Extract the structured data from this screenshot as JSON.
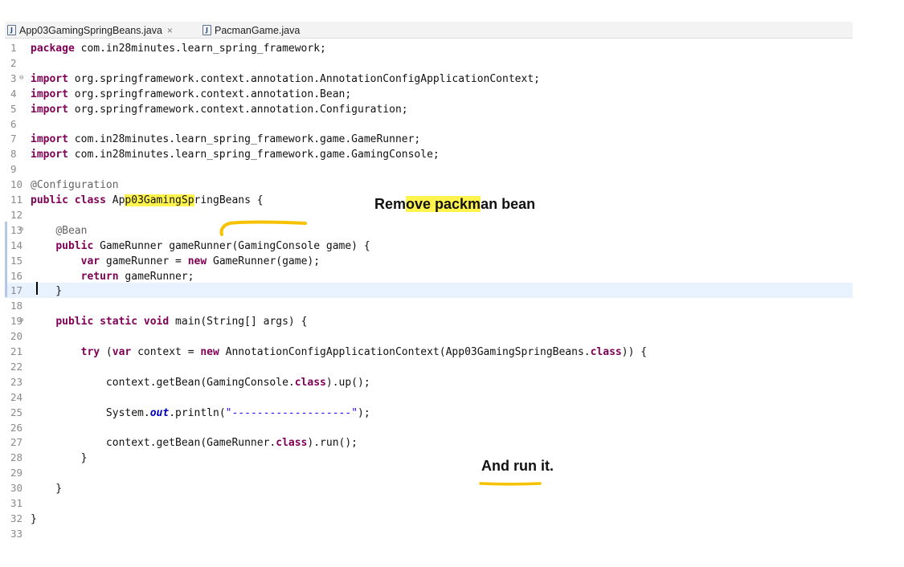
{
  "tabs": [
    {
      "label": "App03GamingSpringBeans.java",
      "active": true,
      "closable": true
    },
    {
      "label": "PacmanGame.java",
      "active": false,
      "closable": false
    }
  ],
  "icons": {
    "file": "java-file-icon",
    "close": "close-icon",
    "fold": "fold-minus-icon"
  },
  "colors": {
    "keyword": "#7f0055",
    "annotation": "#646464",
    "string": "#2a00ff",
    "highlight": "#fff34d",
    "pen": "#f6c200",
    "current_line": "#e8f2fe"
  },
  "code_lines": [
    {
      "n": "1",
      "html": "<span class='kw'>package</span> com.in28minutes.learn_spring_framework;"
    },
    {
      "n": "2",
      "html": ""
    },
    {
      "n": "3",
      "fold": true,
      "html": "<span class='kw'>import</span> org.springframework.context.annotation.AnnotationConfigApplicationContext;"
    },
    {
      "n": "4",
      "html": "<span class='kw'>import</span> org.springframework.context.annotation.Bean;"
    },
    {
      "n": "5",
      "html": "<span class='kw'>import</span> org.springframework.context.annotation.Configuration;"
    },
    {
      "n": "6",
      "html": ""
    },
    {
      "n": "7",
      "html": "<span class='kw'>import</span> com.in28minutes.learn_spring_framework.game.GameRunner;"
    },
    {
      "n": "8",
      "html": "<span class='kw'>import</span> com.in28minutes.learn_spring_framework.game.GamingConsole;"
    },
    {
      "n": "9",
      "html": ""
    },
    {
      "n": "10",
      "html": "<span class='an'>@Configuration</span>"
    },
    {
      "n": "11",
      "html": "<span class='kw'>public</span> <span class='kw'>class</span> Ap<span class='hl'>p03GamingSp</span>ringBeans {"
    },
    {
      "n": "12",
      "html": ""
    },
    {
      "n": "13",
      "fold": true,
      "html": "    <span class='an'>@Bean</span>"
    },
    {
      "n": "14",
      "html": "    <span class='kw'>public</span> GameRunner gameRunner(GamingConsole game) {"
    },
    {
      "n": "15",
      "html": "        <span class='kw'>var</span> gameRunner = <span class='kw'>new</span> GameRunner(game);"
    },
    {
      "n": "16",
      "html": "        <span class='kw'>return</span> gameRunner;"
    },
    {
      "n": "17",
      "current": true,
      "html": "    }"
    },
    {
      "n": "18",
      "html": ""
    },
    {
      "n": "19",
      "fold": true,
      "html": "    <span class='kw'>public</span> <span class='kw'>static</span> <span class='kw'>void</span> main(String[] args) {"
    },
    {
      "n": "20",
      "html": ""
    },
    {
      "n": "21",
      "html": "        <span class='kw'>try</span> (<span class='kw'>var</span> context = <span class='kw'>new</span> AnnotationConfigApplicationContext(App03GamingSpringBeans.<span class='kw'>class</span>)) {"
    },
    {
      "n": "22",
      "html": ""
    },
    {
      "n": "23",
      "html": "            context.getBean(GamingConsole.<span class='kw'>class</span>).up();"
    },
    {
      "n": "24",
      "html": ""
    },
    {
      "n": "25",
      "html": "            System.<span class='fi'>out</span>.println(<span class='st'>\"-------------------\"</span>);"
    },
    {
      "n": "26",
      "html": ""
    },
    {
      "n": "27",
      "html": "            context.getBean(GameRunner.<span class='kw'>class</span>).run();"
    },
    {
      "n": "28",
      "html": "        }"
    },
    {
      "n": "29",
      "html": ""
    },
    {
      "n": "30",
      "html": "    }"
    },
    {
      "n": "31",
      "html": ""
    },
    {
      "n": "32",
      "html": "}"
    },
    {
      "n": "33",
      "html": ""
    }
  ],
  "annotations": {
    "note1_pre": "Rem",
    "note1_hl": "ove packm",
    "note1_post": "an bean",
    "note2": "And run it."
  }
}
